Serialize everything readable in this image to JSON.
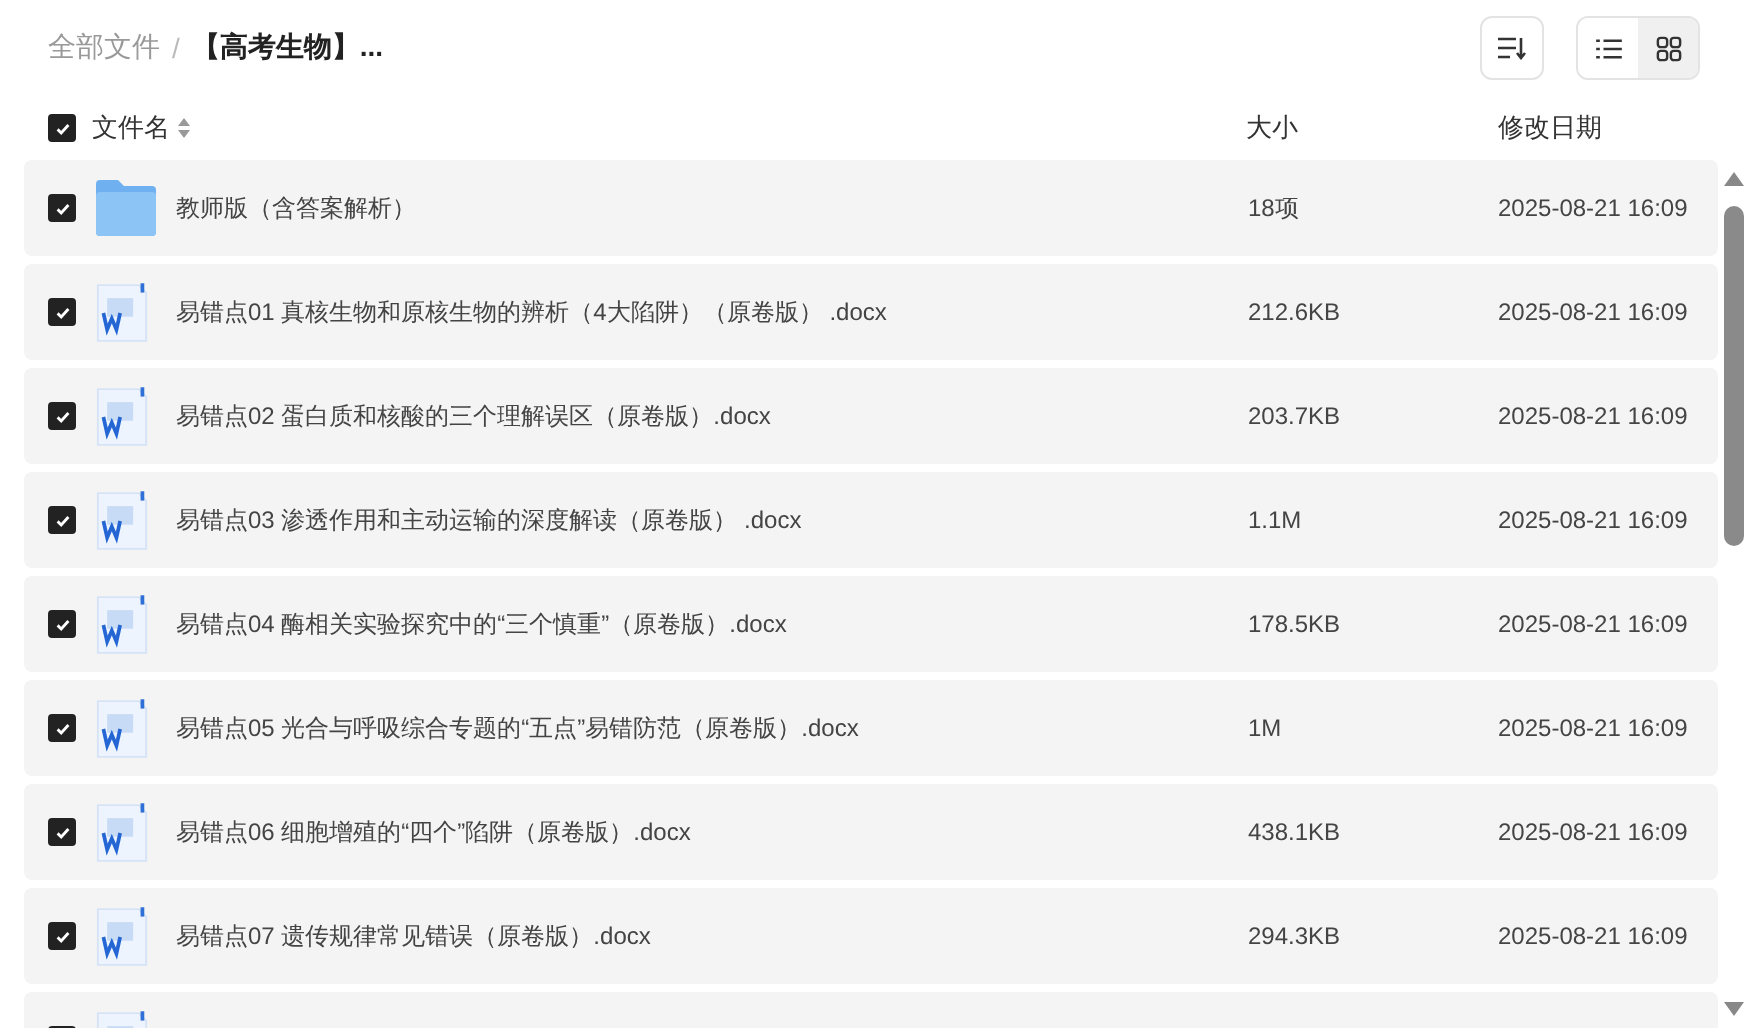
{
  "breadcrumb_separator": "/",
  "breadcrumb": [
    {
      "label": "全部文件",
      "current": false
    },
    {
      "label": "【高考生物】...",
      "current": true
    }
  ],
  "view_toggle": [
    {
      "kind": "list",
      "selected": false
    },
    {
      "kind": "grid",
      "selected": true
    }
  ],
  "table": {
    "select_all": {
      "checked": true
    },
    "columns": [
      "文件名",
      "大小",
      "修改日期"
    ],
    "rows": [
      {
        "kind": "folder",
        "checked": true,
        "name": "教师版（含答案解析）",
        "size": "18项",
        "modified": "2025-08-21 16:09"
      },
      {
        "kind": "doc",
        "checked": true,
        "name": "易错点01 真核生物和原核生物的辨析（4大陷阱）（原卷版） .docx",
        "size": "212.6KB",
        "modified": "2025-08-21 16:09"
      },
      {
        "kind": "doc",
        "checked": true,
        "name": "易错点02 蛋白质和核酸的三个理解误区（原卷版）.docx",
        "size": "203.7KB",
        "modified": "2025-08-21 16:09"
      },
      {
        "kind": "doc",
        "checked": true,
        "name": "易错点03 渗透作用和主动运输的深度解读（原卷版） .docx",
        "size": "1.1M",
        "modified": "2025-08-21 16:09"
      },
      {
        "kind": "doc",
        "checked": true,
        "name": "易错点04 酶相关实验探究中的“三个慎重”（原卷版）.docx",
        "size": "178.5KB",
        "modified": "2025-08-21 16:09"
      },
      {
        "kind": "doc",
        "checked": true,
        "name": "易错点05 光合与呼吸综合专题的“五点”易错防范（原卷版）.docx",
        "size": "1M",
        "modified": "2025-08-21 16:09"
      },
      {
        "kind": "doc",
        "checked": true,
        "name": "易错点06 细胞增殖的“四个”陷阱（原卷版）.docx",
        "size": "438.1KB",
        "modified": "2025-08-21 16:09"
      },
      {
        "kind": "doc",
        "checked": true,
        "name": "易错点07 遗传规律常见错误（原卷版）.docx",
        "size": "294.3KB",
        "modified": "2025-08-21 16:09"
      },
      {
        "kind": "doc",
        "checked": true
      }
    ]
  }
}
